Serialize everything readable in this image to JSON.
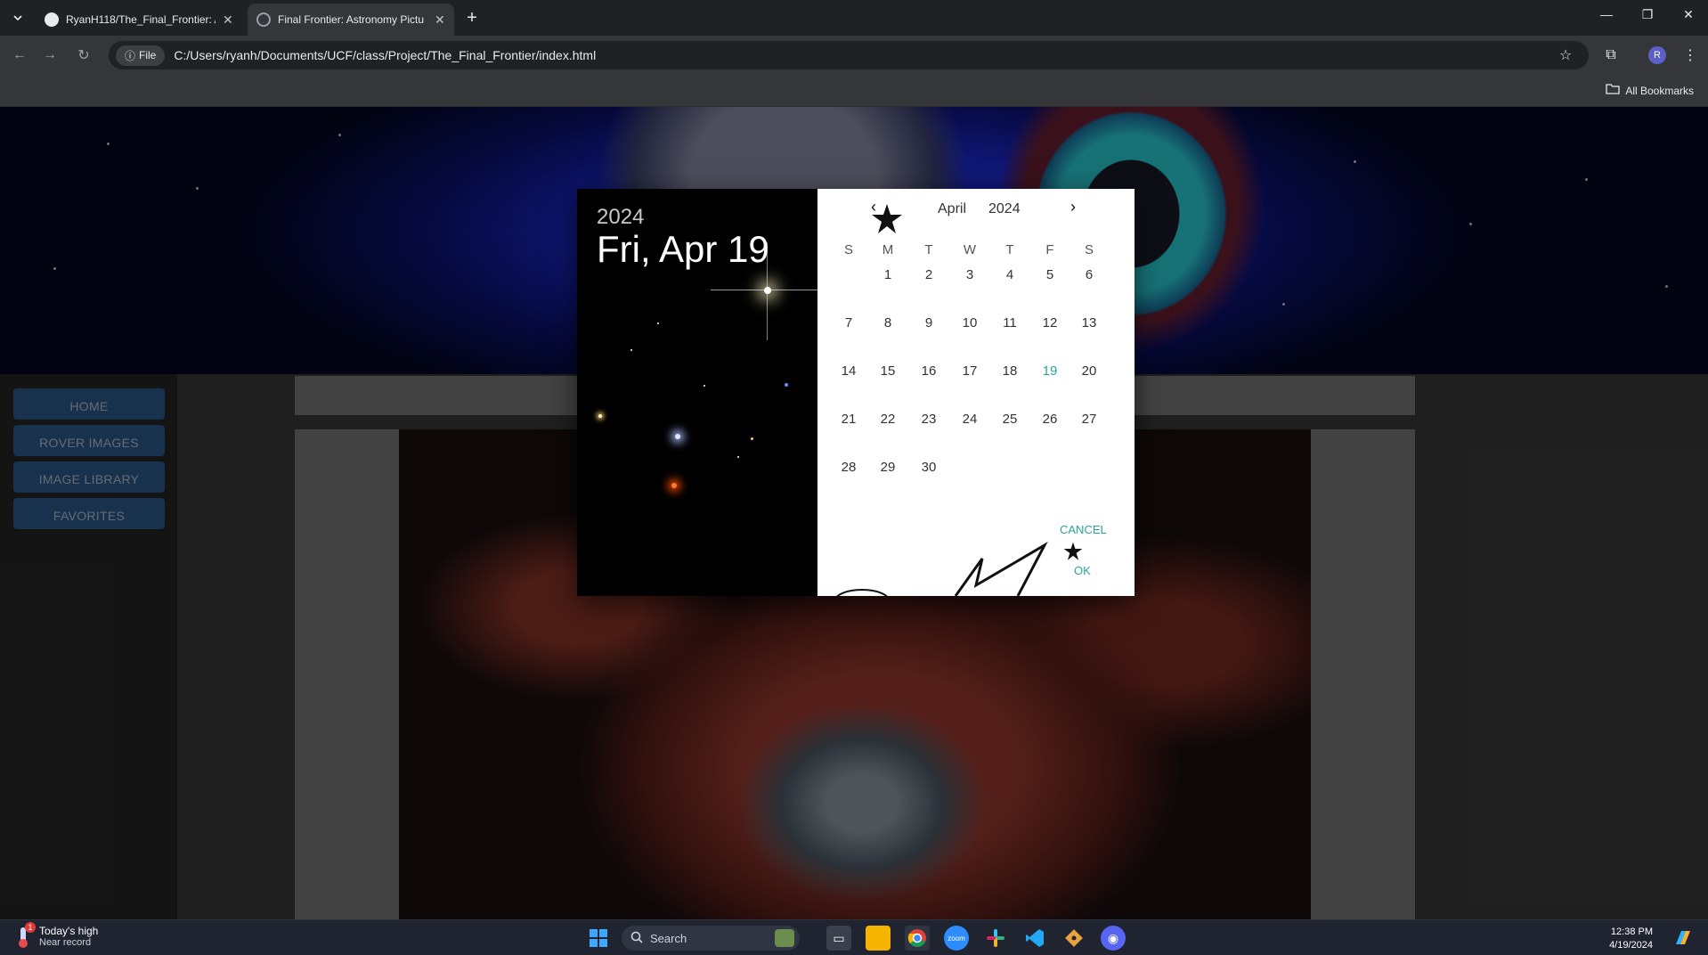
{
  "browser": {
    "tabs": [
      {
        "label": "RyanH118/The_Final_Frontier: A"
      },
      {
        "label": "Final Frontier: Astronomy Pictu"
      }
    ],
    "file_chip": "File",
    "url": "C:/Users/ryanh/Documents/UCF/class/Project/The_Final_Frontier/index.html",
    "avatar_letter": "R",
    "all_bookmarks": "All Bookmarks"
  },
  "sidebar": {
    "items": [
      {
        "label": "HOME"
      },
      {
        "label": "ROVER IMAGES"
      },
      {
        "label": "IMAGE LIBRARY"
      },
      {
        "label": "FAVORITES"
      }
    ]
  },
  "datepicker": {
    "header_year": "2024",
    "header_date": "Fri, Apr 19",
    "month": "April",
    "year": "2024",
    "weekdays": [
      "S",
      "M",
      "T",
      "W",
      "T",
      "F",
      "S"
    ],
    "days": [
      "1",
      "2",
      "3",
      "4",
      "5",
      "6",
      "7",
      "8",
      "9",
      "10",
      "11",
      "12",
      "13",
      "14",
      "15",
      "16",
      "17",
      "18",
      "19",
      "20",
      "21",
      "22",
      "23",
      "24",
      "25",
      "26",
      "27",
      "28",
      "29",
      "30"
    ],
    "selected_day": "19",
    "cancel_label": "CANCEL",
    "ok_label": "OK",
    "accent_color": "#26a69a"
  },
  "taskbar": {
    "weather_title": "Today's high",
    "weather_sub": "Near record",
    "weather_badge": "1",
    "search_placeholder": "Search",
    "time": "12:38 PM",
    "date": "4/19/2024"
  },
  "colors": {
    "nav_button": "#2d5a8c",
    "chrome_bg": "#35363a",
    "taskbar_bg": "#1f2430"
  }
}
